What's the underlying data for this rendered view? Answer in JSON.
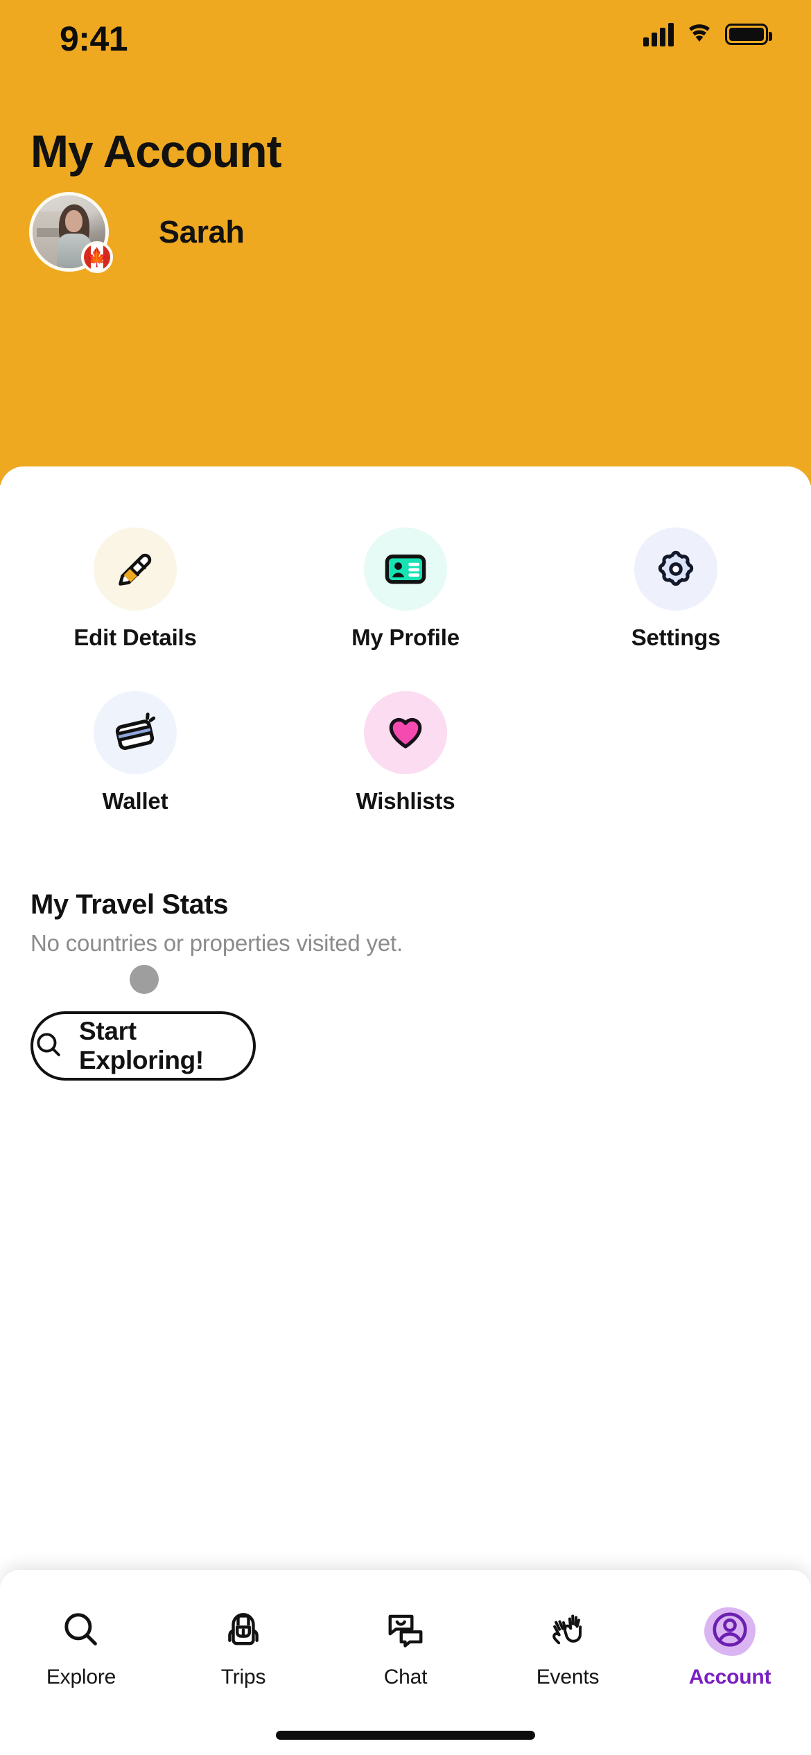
{
  "status_bar": {
    "time": "9:41",
    "signal_icon": "cellular-signal-icon",
    "wifi_icon": "wifi-icon",
    "battery_icon": "battery-icon"
  },
  "header": {
    "title": "My Account",
    "background_color": "#EEA921",
    "profile": {
      "name": "Sarah",
      "avatar_icon": "user-avatar-photo",
      "flag_badge": "canada-flag-badge",
      "flag_glyph": "🍁"
    }
  },
  "actions": [
    {
      "label": "Edit Details",
      "icon": "pencil-icon",
      "circle_color": "#FBF5E6",
      "accent": "#EEA921"
    },
    {
      "label": "My Profile",
      "icon": "id-card-icon",
      "circle_color": "#E7FBF6",
      "accent": "#16E2B4"
    },
    {
      "label": "Settings",
      "icon": "gear-icon",
      "circle_color": "#EEF1FB",
      "accent": "#DCE4F7"
    },
    {
      "label": "Wallet",
      "icon": "credit-card-icon",
      "circle_color": "#EFF3FC",
      "accent": "#8FA8DC"
    },
    {
      "label": "Wishlists",
      "icon": "heart-icon",
      "circle_color": "#FBDCF0",
      "accent": "#F54BB0"
    }
  ],
  "travel_stats": {
    "title": "My Travel Stats",
    "empty_message": "No countries or properties visited yet.",
    "placeholder_dot_color": "#9e9e9e"
  },
  "explore_button": {
    "label": "Start Exploring!",
    "icon": "search-icon"
  },
  "bottom_nav": {
    "active_color": "#7A1FC0",
    "items": [
      {
        "label": "Explore",
        "icon": "magnifier-icon",
        "active": false
      },
      {
        "label": "Trips",
        "icon": "backpack-icon",
        "active": false
      },
      {
        "label": "Chat",
        "icon": "chat-bubbles-icon",
        "active": false
      },
      {
        "label": "Events",
        "icon": "waving-hands-icon",
        "active": false
      },
      {
        "label": "Account",
        "icon": "user-circle-icon",
        "active": true
      }
    ]
  }
}
